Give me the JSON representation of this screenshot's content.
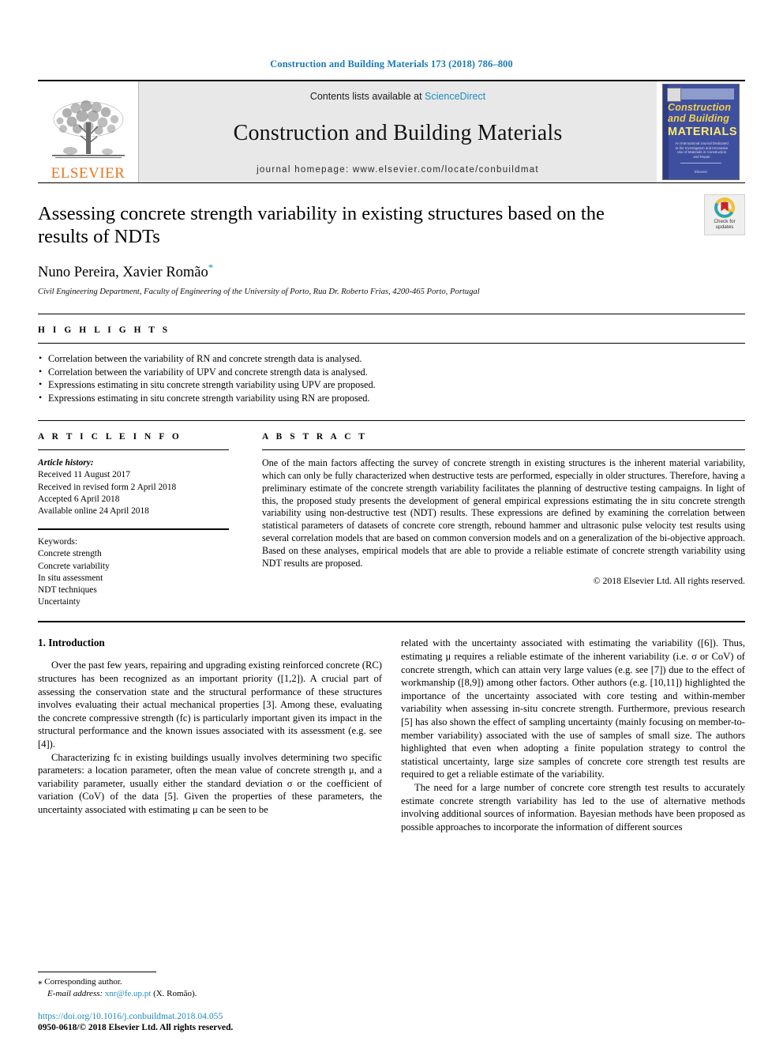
{
  "running_head": "Construction and Building Materials 173 (2018) 786–800",
  "masthead": {
    "publisher_name": "ELSEVIER",
    "contents_prefix": "Contents lists available at",
    "sciencedirect": "ScienceDirect",
    "journal_title": "Construction and Building Materials",
    "homepage": "journal homepage: www.elsevier.com/locate/conbuildmat",
    "cover": {
      "line1": "Construction",
      "line2": "and Building",
      "line3": "MATERIALS",
      "subtext": "An International Journal Dedicated to the Investigation and Innovative Use of Materials in Construction and Repair",
      "footer": "Elsevier"
    }
  },
  "article": {
    "title": "Assessing concrete strength variability in existing structures based on the results of NDTs",
    "authors": "Nuno Pereira, Xavier Romão",
    "corresponding_marker": "*",
    "affiliation": "Civil Engineering Department, Faculty of Engineering of the University of Porto, Rua Dr. Roberto Frias, 4200-465 Porto, Portugal",
    "crossmark": {
      "line1": "Check for",
      "line2": "updates"
    }
  },
  "highlights": {
    "heading": "H I G H L I G H T S",
    "items": [
      "Correlation between the variability of RN and concrete strength data is analysed.",
      "Correlation between the variability of UPV and concrete strength data is analysed.",
      "Expressions estimating in situ concrete strength variability using UPV are proposed.",
      "Expressions estimating in situ concrete strength variability using RN are proposed."
    ]
  },
  "article_info": {
    "heading": "A R T I C L E   I N F O",
    "history_label": "Article history:",
    "history": [
      "Received 11 August 2017",
      "Received in revised form 2 April 2018",
      "Accepted 6 April 2018",
      "Available online 24 April 2018"
    ],
    "keywords_label": "Keywords:",
    "keywords": [
      "Concrete strength",
      "Concrete variability",
      "In situ assessment",
      "NDT techniques",
      "Uncertainty"
    ]
  },
  "abstract": {
    "heading": "A B S T R A C T",
    "text": "One of the main factors affecting the survey of concrete strength in existing structures is the inherent material variability, which can only be fully characterized when destructive tests are performed, especially in older structures. Therefore, having a preliminary estimate of the concrete strength variability facilitates the planning of destructive testing campaigns. In light of this, the proposed study presents the development of general empirical expressions estimating the in situ concrete strength variability using non-destructive test (NDT) results. These expressions are defined by examining the correlation between statistical parameters of datasets of concrete core strength, rebound hammer and ultrasonic pulse velocity test results using several correlation models that are based on common conversion models and on a generalization of the bi-objective approach. Based on these analyses, empirical models that are able to provide a reliable estimate of concrete strength variability using NDT results are proposed.",
    "copyright": "© 2018 Elsevier Ltd. All rights reserved."
  },
  "body": {
    "section_heading": "1. Introduction",
    "left_paragraphs": [
      "Over the past few years, repairing and upgrading existing reinforced concrete (RC) structures has been recognized as an important priority ([1,2]). A crucial part of assessing the conservation state and the structural performance of these structures involves evaluating their actual mechanical properties [3]. Among these, evaluating the concrete compressive strength (fc) is particularly important given its impact in the structural performance and the known issues associated with its assessment (e.g. see [4]).",
      "Characterizing fc in existing buildings usually involves determining two specific parameters: a location parameter, often the mean value of concrete strength μ, and a variability parameter, usually either the standard deviation σ or the coefficient of variation (CoV) of the data [5]. Given the properties of these parameters, the uncertainty associated with estimating μ can be seen to be"
    ],
    "right_paragraphs": [
      "related with the uncertainty associated with estimating the variability ([6]). Thus, estimating μ requires a reliable estimate of the inherent variability (i.e. σ or CoV) of concrete strength, which can attain very large values (e.g. see [7]) due to the effect of workmanship ([8,9]) among other factors. Other authors (e.g. [10,11]) highlighted the importance of the uncertainty associated with core testing and within-member variability when assessing in-situ concrete strength. Furthermore, previous research [5] has also shown the effect of sampling uncertainty (mainly focusing on member-to-member variability) associated with the use of samples of small size. The authors highlighted that even when adopting a finite population strategy to control the statistical uncertainty, large size samples of concrete core strength test results are required to get a reliable estimate of the variability.",
      "The need for a large number of concrete core strength test results to accurately estimate concrete strength variability has led to the use of alternative methods involving additional sources of information. Bayesian methods have been proposed as possible approaches to incorporate the information of different sources"
    ]
  },
  "footnote": {
    "corresponding_mark": "⁎",
    "corresponding_text": "Corresponding author.",
    "email_label": "E-mail address:",
    "email": "xnr@fe.up.pt",
    "email_owner": "(X. Romão)."
  },
  "footer": {
    "doi": "https://doi.org/10.1016/j.conbuildmat.2018.04.055",
    "issn": "0950-0618/© 2018 Elsevier Ltd. All rights reserved."
  },
  "colors": {
    "link": "#1f8ac0",
    "elsevier_orange": "#e87722",
    "cover_blue": "#3f4fa0"
  }
}
